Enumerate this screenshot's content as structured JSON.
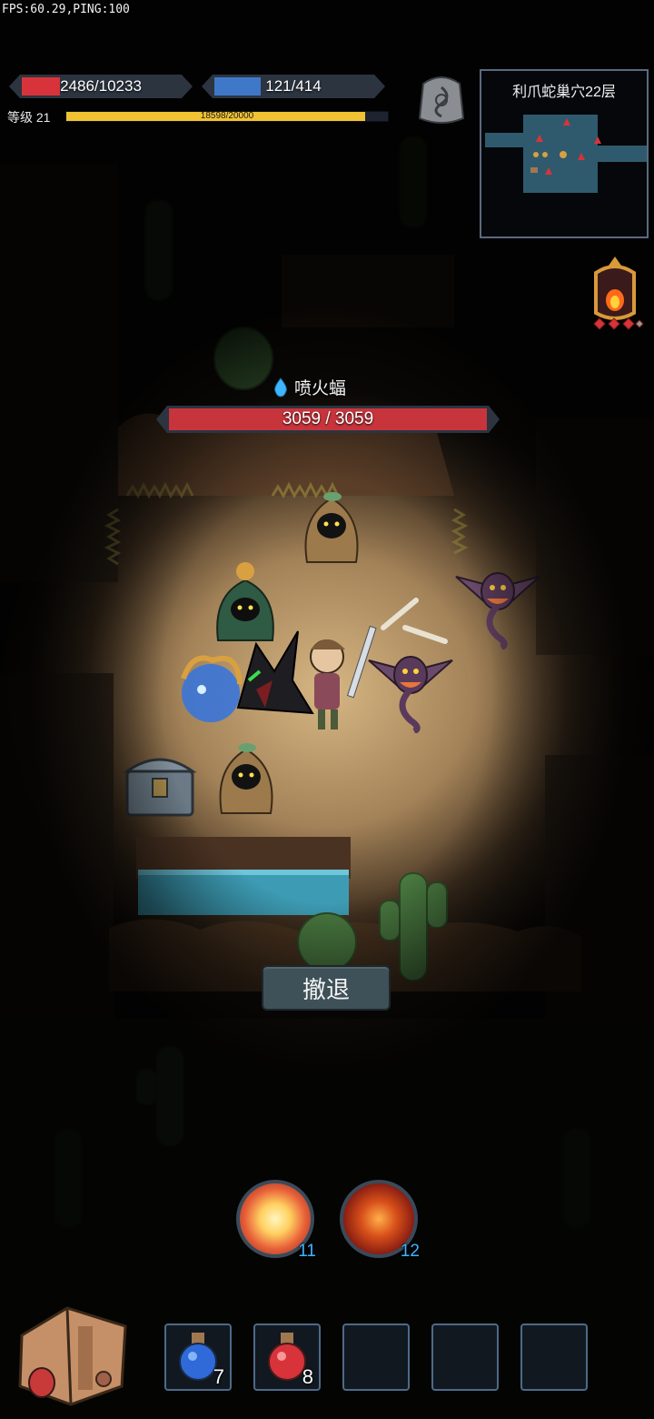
{
  "hud": {
    "fps_text": "FPS:60.29,PING:100",
    "hp_text": "2486/10233",
    "hp_fraction": 0.243,
    "mp_text": "121/414",
    "mp_fraction": 0.292,
    "level_label": "等级 21",
    "xp_text": "18598/20000",
    "xp_fraction": 0.93
  },
  "minimap": {
    "title": "利爪蛇巢穴22层"
  },
  "target": {
    "name": "喷火蝠",
    "hp_text": "3059 / 3059",
    "hp_fraction": 1.0,
    "element_icon": "water-drop-icon"
  },
  "actions": {
    "retreat_label": "撤退"
  },
  "skills": [
    {
      "name": "burst-skill",
      "count": "11"
    },
    {
      "name": "fire-vortex-skill",
      "count": "12"
    }
  ],
  "quickbar": [
    {
      "item": "blue-potion",
      "count": "7"
    },
    {
      "item": "red-potion",
      "count": "8"
    },
    {
      "item": "",
      "count": ""
    },
    {
      "item": "",
      "count": ""
    },
    {
      "item": "",
      "count": ""
    }
  ],
  "colors": {
    "hp": "#d8333a",
    "mp": "#3f78c8",
    "xp": "#f1c232",
    "skill_count": "#3fb4ff"
  }
}
